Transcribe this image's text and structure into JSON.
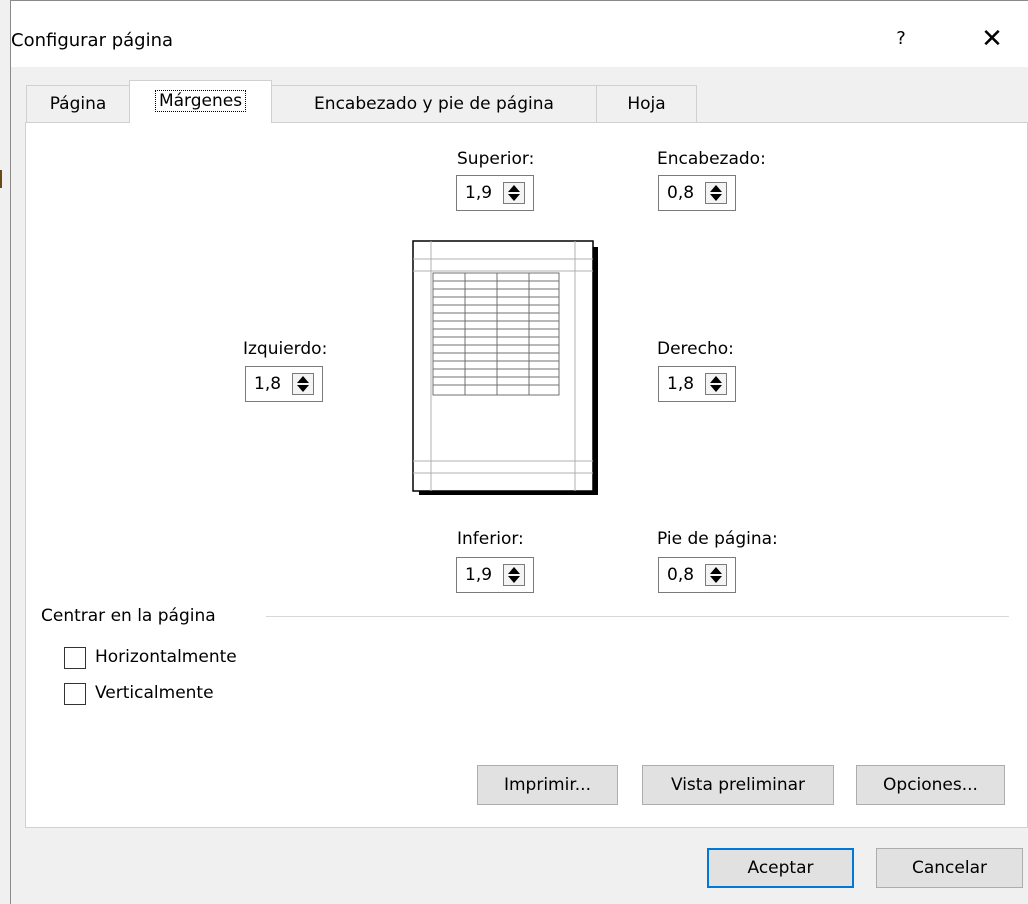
{
  "window": {
    "title": "Configurar página",
    "help": "?",
    "close": "✕"
  },
  "tabs": [
    {
      "label": "Página"
    },
    {
      "label": "Márgenes"
    },
    {
      "label": "Encabezado y pie de página"
    },
    {
      "label": "Hoja"
    }
  ],
  "margins": {
    "top": {
      "label": "Superior:",
      "value": "1,9"
    },
    "header": {
      "label": "Encabezado:",
      "value": "0,8"
    },
    "left": {
      "label": "Izquierdo:",
      "value": "1,8"
    },
    "right": {
      "label": "Derecho:",
      "value": "1,8"
    },
    "bottom": {
      "label": "Inferior:",
      "value": "1,9"
    },
    "footer": {
      "label": "Pie de página:",
      "value": "0,8"
    }
  },
  "center": {
    "group_label": "Centrar en la página",
    "horizontal": {
      "label": "Horizontalmente",
      "checked": false
    },
    "vertical": {
      "label": "Verticalmente",
      "checked": false
    }
  },
  "buttons": {
    "print": "Imprimir...",
    "preview": "Vista preliminar",
    "options": "Opciones...",
    "ok": "Aceptar",
    "cancel": "Cancelar"
  },
  "colors": {
    "accent": "#0078d7",
    "panel": "#ffffff",
    "background": "#f0f0f0"
  }
}
